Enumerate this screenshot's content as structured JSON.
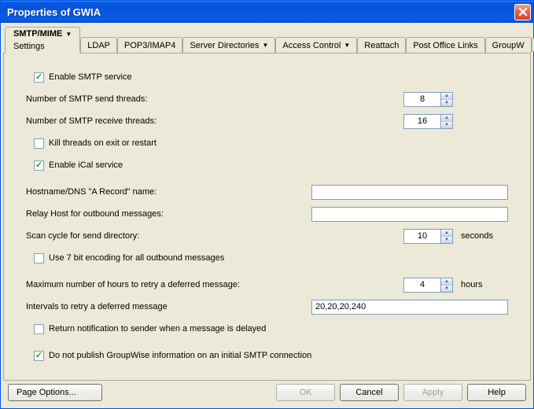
{
  "titlebar": {
    "title": "Properties of GWIA"
  },
  "tabs": {
    "active": {
      "label": "SMTP/MIME",
      "sub": "Settings"
    },
    "others": [
      "LDAP",
      "POP3/IMAP4",
      "Server Directories",
      "Access Control",
      "Reattach",
      "Post Office Links",
      "GroupW"
    ]
  },
  "form": {
    "enable_smtp": {
      "label": "Enable SMTP service",
      "checked": true
    },
    "send_threads": {
      "label": "Number of SMTP send threads:",
      "value": "8"
    },
    "recv_threads": {
      "label": "Number of SMTP receive threads:",
      "value": "16"
    },
    "kill_threads": {
      "label": "Kill threads on exit or restart",
      "checked": false
    },
    "enable_ical": {
      "label": "Enable iCal service",
      "checked": true
    },
    "hostname": {
      "label": "Hostname/DNS \"A Record\" name:",
      "value": ""
    },
    "relay_host": {
      "label": "Relay Host for outbound messages:",
      "value": ""
    },
    "scan_cycle": {
      "label": "Scan cycle for send directory:",
      "value": "10",
      "unit": "seconds"
    },
    "use7bit": {
      "label": "Use 7 bit encoding for all outbound messages",
      "checked": false
    },
    "max_hours": {
      "label": "Maximum number of hours to retry a deferred message:",
      "value": "4",
      "unit": "hours"
    },
    "intervals": {
      "label": "Intervals to retry a deferred message",
      "value": "20,20,20,240"
    },
    "return_notif": {
      "label": "Return notification to sender when a message is delayed",
      "checked": false
    },
    "no_publish": {
      "label": "Do not publish GroupWise information on an initial SMTP connection",
      "checked": true
    }
  },
  "buttons": {
    "page_options": "Page Options...",
    "ok": "OK",
    "cancel": "Cancel",
    "apply": "Apply",
    "help": "Help"
  }
}
